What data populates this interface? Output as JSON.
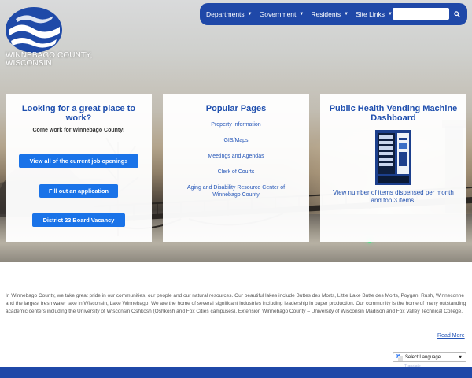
{
  "logo": {
    "line1": "WINNEBAGO COUNTY,",
    "line2": "WISCONSIN"
  },
  "nav": {
    "items": [
      {
        "label": "Departments"
      },
      {
        "label": "Government"
      },
      {
        "label": "Residents"
      },
      {
        "label": "Site Links"
      }
    ],
    "search_placeholder": ""
  },
  "cards": {
    "jobs": {
      "title": "Looking for a great place to work?",
      "subtitle": "Come work for Winnebago County!",
      "buttons": [
        "View all of the current job openings",
        "Fill out an application",
        "District 23 Board Vacancy"
      ]
    },
    "popular": {
      "title": "Popular Pages",
      "links": [
        "Property Information",
        "GIS/Maps",
        "Meetings and Agendas",
        "Clerk of Courts",
        "Aging and Disability Resource Center of Winnebago County"
      ]
    },
    "health": {
      "title": "Public Health Vending Machine Dashboard",
      "description": "View number of items dispensed per month and top 3 items."
    }
  },
  "intro": {
    "text": "In Winnebago County, we take great pride in our communities, our people and our natural resources. Our beautiful lakes include Buttes des Morts, Little Lake Butte des Morts, Poygan, Rush, Winneconne and the largest fresh water lake in Wisconsin, Lake Winnebago. We are the home of several significant industries including leadership in paper production. Our community is the home of many outstanding academic centers including the University of Wisconsin Oshkosh (Oshkosh and Fox Cities campuses), Extension Winnebago County – University of Wisconsin Madison and Fox Valley Technical College.",
    "read_more": "Read More"
  },
  "translate": {
    "label": "Select Language",
    "sub": "Translate"
  },
  "colors": {
    "brand_blue": "#1f48a8",
    "button_blue": "#1a73e8",
    "title_blue": "#1f4fae"
  },
  "icons": [
    "logo-waves-icon",
    "search-icon",
    "google-translate-icon",
    "chevron-down-icon"
  ]
}
